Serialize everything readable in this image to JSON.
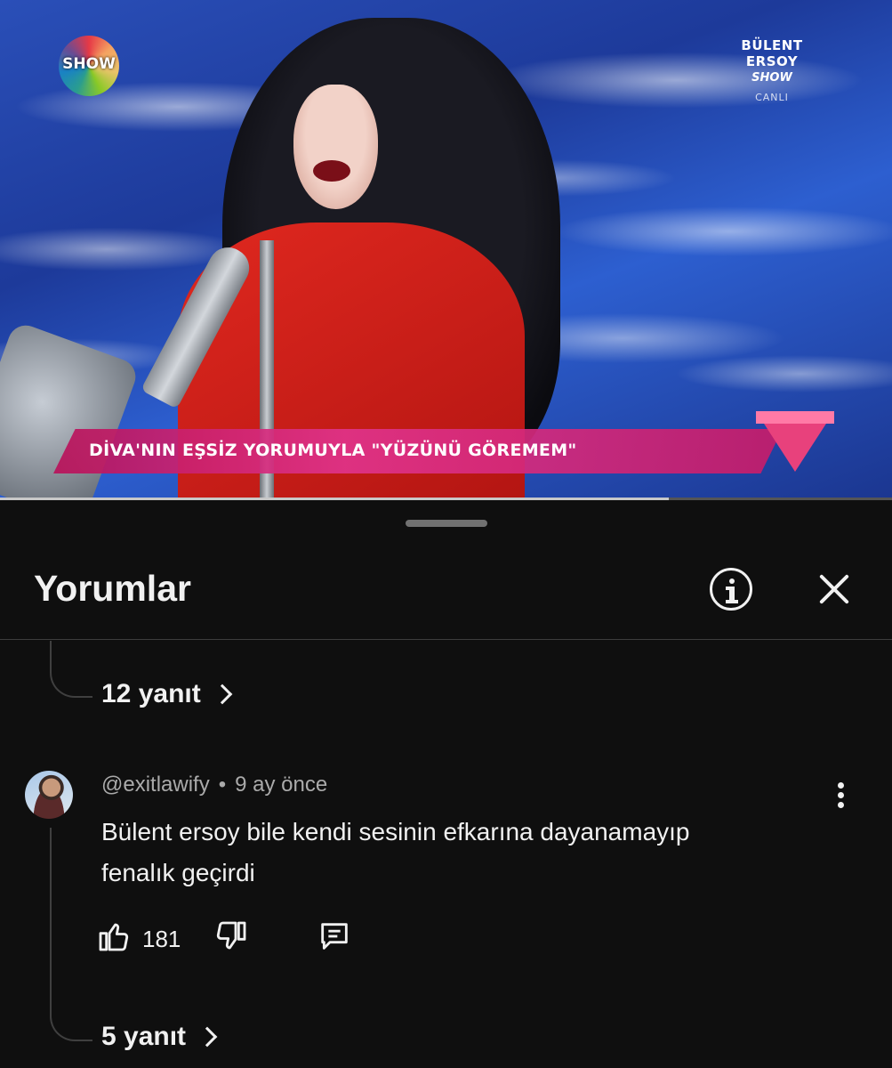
{
  "video": {
    "channel_logo": "SHOW",
    "show_tag_line1": "BÜLENT ERSOY",
    "show_tag_line2": "SHOW",
    "show_tag_line3": "CANLI",
    "ticker": "DİVA'NIN EŞSİZ YORUMUYLA \"YÜZÜNÜ GÖREMEM\"",
    "progress_fraction": 0.75
  },
  "comments_panel": {
    "title": "Yorumlar",
    "info_icon": "info-icon",
    "close_icon": "close-icon"
  },
  "thread": {
    "prev_replies": "12 yanıt"
  },
  "comment": {
    "author": "@exitlawify",
    "separator": "•",
    "time": "9 ay önce",
    "text_line1": "Bülent ersoy bile kendi sesinin efkarına dayanamayıp",
    "text_line2": "fenalık geçirdi",
    "like_count": "181",
    "replies": "5 yanıt",
    "icons": [
      "like-icon",
      "dislike-icon",
      "reply-icon",
      "more-icon"
    ]
  }
}
